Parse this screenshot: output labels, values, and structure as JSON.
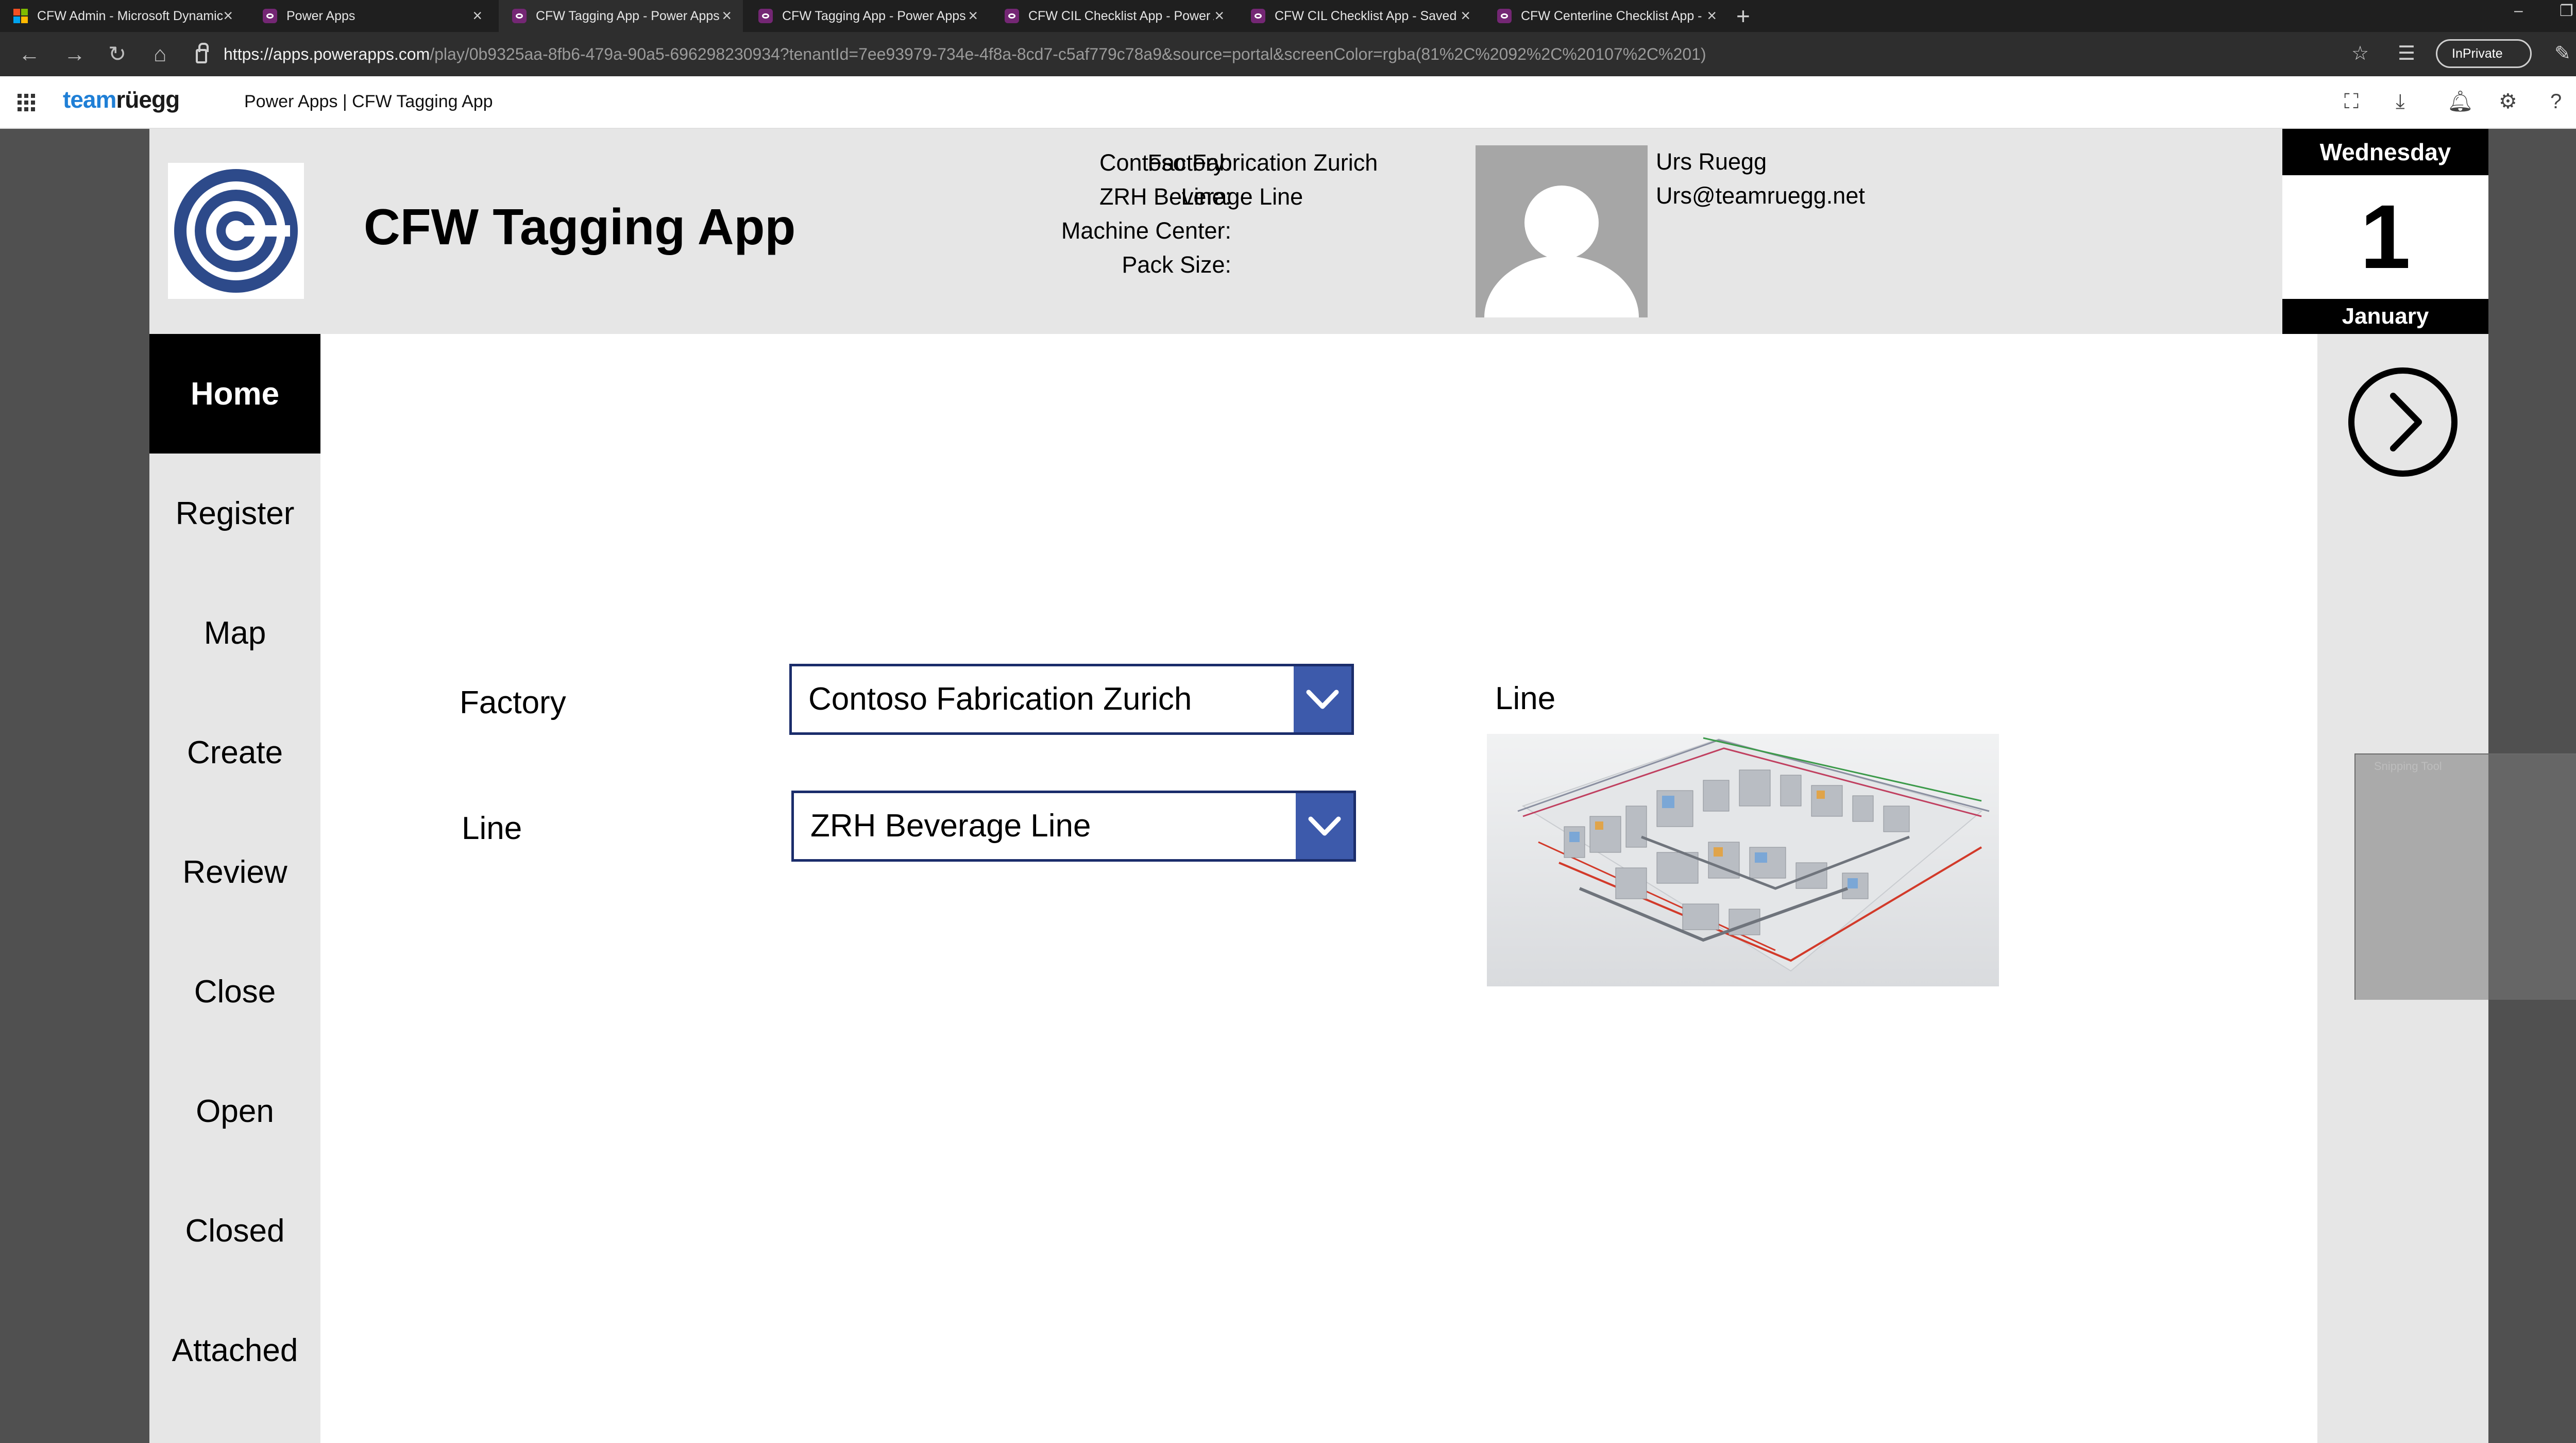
{
  "browser": {
    "tabs": [
      {
        "title": "CFW Admin - Microsoft Dynamics",
        "icon": "dynamics-icon",
        "active": false
      },
      {
        "title": "Power Apps",
        "icon": "power-apps-icon",
        "active": false
      },
      {
        "title": "CFW Tagging App - Power Apps",
        "icon": "power-apps-icon",
        "active": true
      },
      {
        "title": "CFW Tagging App - Power Apps",
        "icon": "power-apps-icon",
        "active": false
      },
      {
        "title": "CFW CIL Checklist App - Power Apps",
        "icon": "power-apps-icon",
        "active": false
      },
      {
        "title": "CFW CIL Checklist App - Saved (Unpublished)",
        "icon": "power-apps-icon",
        "active": false
      },
      {
        "title": "CFW Centerline Checklist App - Power Apps",
        "icon": "power-apps-icon",
        "active": false
      }
    ],
    "url_host": "https://apps.powerapps.com",
    "url_path": "/play/0b9325aa-8fb6-479a-90a5-696298230934?tenantId=7ee93979-734e-4f8a-8cd7-c5af779c78a9&source=portal&screenColor=rgba(81%2C%2092%2C%20107%2C%201)",
    "inprivate_label": "InPrivate"
  },
  "pa_header": {
    "brand_part1": "team",
    "brand_part2": "rüegg",
    "breadcrumb": "Power Apps  |  CFW Tagging App"
  },
  "app": {
    "title": "CFW Tagging App",
    "info": {
      "factory_label": "Factory:",
      "factory_value": "Contoso Fabrication Zurich",
      "line_label": "Line:",
      "line_value": "ZRH Beverage Line",
      "machine_center_label": "Machine Center:",
      "pack_size_label": "Pack Size:"
    },
    "user": {
      "name": "Urs Ruegg",
      "email": "Urs@teamruegg.net"
    },
    "date": {
      "weekday": "Wednesday",
      "day": "1",
      "month": "January"
    },
    "nav": [
      {
        "label": "Home",
        "active": true
      },
      {
        "label": "Register",
        "active": false
      },
      {
        "label": "Map",
        "active": false
      },
      {
        "label": "Create",
        "active": false
      },
      {
        "label": "Review",
        "active": false
      },
      {
        "label": "Close",
        "active": false
      },
      {
        "label": "Open",
        "active": false
      },
      {
        "label": "Closed",
        "active": false
      },
      {
        "label": "Attached",
        "active": false
      }
    ],
    "form": {
      "factory_label": "Factory",
      "factory_selected": "Contoso Fabrication Zurich",
      "line_label": "Line",
      "line_selected": "ZRH Beverage Line",
      "image_label": "Line"
    }
  },
  "snipping_tool": {
    "label": "Snipping Tool"
  },
  "colors": {
    "dropdown_border": "#1b2d6b",
    "dropdown_chevron_bg": "#3d5aab",
    "panel_gray": "#e6e6e6",
    "nav_active_bg": "#000000",
    "brand_blue": "#1f7fd6",
    "power_apps_purple": "#742774"
  }
}
